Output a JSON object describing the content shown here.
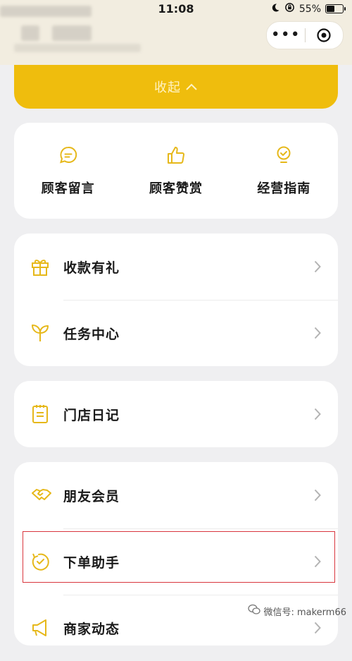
{
  "status_bar": {
    "time": "11:08",
    "battery": "55%",
    "battery_level": 0.55
  },
  "collapse_label": "收起",
  "quick_actions": [
    {
      "label": "顾客留言",
      "icon": "message-icon"
    },
    {
      "label": "顾客赞赏",
      "icon": "thumbs-up-icon"
    },
    {
      "label": "经营指南",
      "icon": "guide-badge-icon"
    }
  ],
  "menu_groups": [
    {
      "items": [
        {
          "label": "收款有礼",
          "icon": "gift-icon"
        },
        {
          "label": "任务中心",
          "icon": "sprout-icon"
        }
      ]
    },
    {
      "items": [
        {
          "label": "门店日记",
          "icon": "notebook-icon"
        }
      ]
    },
    {
      "items": [
        {
          "label": "朋友会员",
          "icon": "handshake-icon"
        },
        {
          "label": "下单助手",
          "icon": "order-assistant-icon"
        },
        {
          "label": "商家动态",
          "icon": "megaphone-icon"
        }
      ]
    }
  ],
  "watermark": "微信号: makerm66",
  "colors": {
    "accent": "#efbd0d",
    "icon": "#e6b81a",
    "highlight": "#d9363e",
    "background": "#efeff1"
  }
}
